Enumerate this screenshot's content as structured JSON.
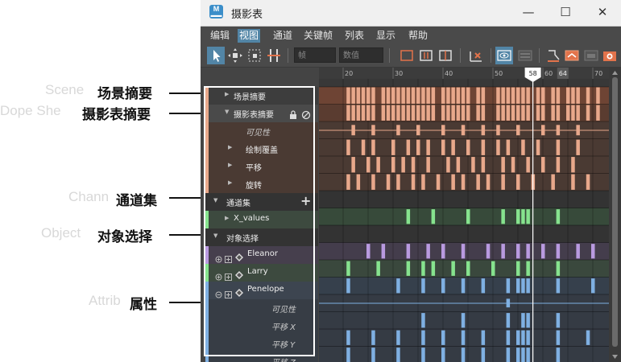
{
  "window": {
    "title": "摄影表",
    "app_icon_label": "M",
    "controls": {
      "minimize": "—",
      "maximize": "☐",
      "close": "✕"
    }
  },
  "menu": {
    "items": [
      {
        "label": "编辑",
        "active": false
      },
      {
        "label": "视图",
        "active": true
      },
      {
        "label": "通道",
        "active": false
      },
      {
        "label": "关键帧",
        "active": false
      },
      {
        "label": "列表",
        "active": false
      },
      {
        "label": "显示",
        "active": false
      },
      {
        "label": "帮助",
        "active": false
      }
    ]
  },
  "toolbar": {
    "frame_placeholder": "帧",
    "value_placeholder": "数值",
    "icons": [
      "select-arrow-icon",
      "move-key-icon",
      "scale-key-icon",
      "insert-key-icon",
      "frame-all-icon",
      "frame-playback-icon",
      "center-current-icon",
      "delete-key-icon",
      "dopesheet-summary-icon",
      "scene-summary-icon",
      "snap-icon",
      "auto-key-icon",
      "bake-icon",
      "camera-icon"
    ]
  },
  "callouts": [
    {
      "label": "场景摘要",
      "ghost": "Scene"
    },
    {
      "label": "摄影表摘要",
      "ghost": "Dope She"
    },
    {
      "label": "通道集",
      "ghost": "Chann"
    },
    {
      "label": "对象选择",
      "ghost": "Object"
    },
    {
      "label": "属性",
      "ghost": "Attrib"
    }
  ],
  "outliner": {
    "scene_summary": "场景摘要",
    "dopesheet_summary": "摄影表摘要",
    "dopesheet_children": [
      "可见性",
      "绘制覆盖",
      "平移",
      "旋转"
    ],
    "channel_sets": "通道集",
    "channel_set_item": "X_values",
    "object_selection": "对象选择",
    "objects": [
      "Eleanor",
      "Larry",
      "Penelope"
    ],
    "attributes": [
      "可见性",
      "平移 X",
      "平移 Y",
      "平移 Z"
    ]
  },
  "timeline": {
    "ruler_labels": [
      20,
      30,
      40,
      50,
      60,
      70
    ],
    "current_frame": 58,
    "marker_frame": 64
  },
  "colors": {
    "summary_key": "#e8a88b",
    "summary_bg": "#6e4434",
    "channelset_key": "#86e38e",
    "eleanor_key": "#b99ae0",
    "penelope_key": "#7fb0e2",
    "accent": "#5285a6"
  }
}
